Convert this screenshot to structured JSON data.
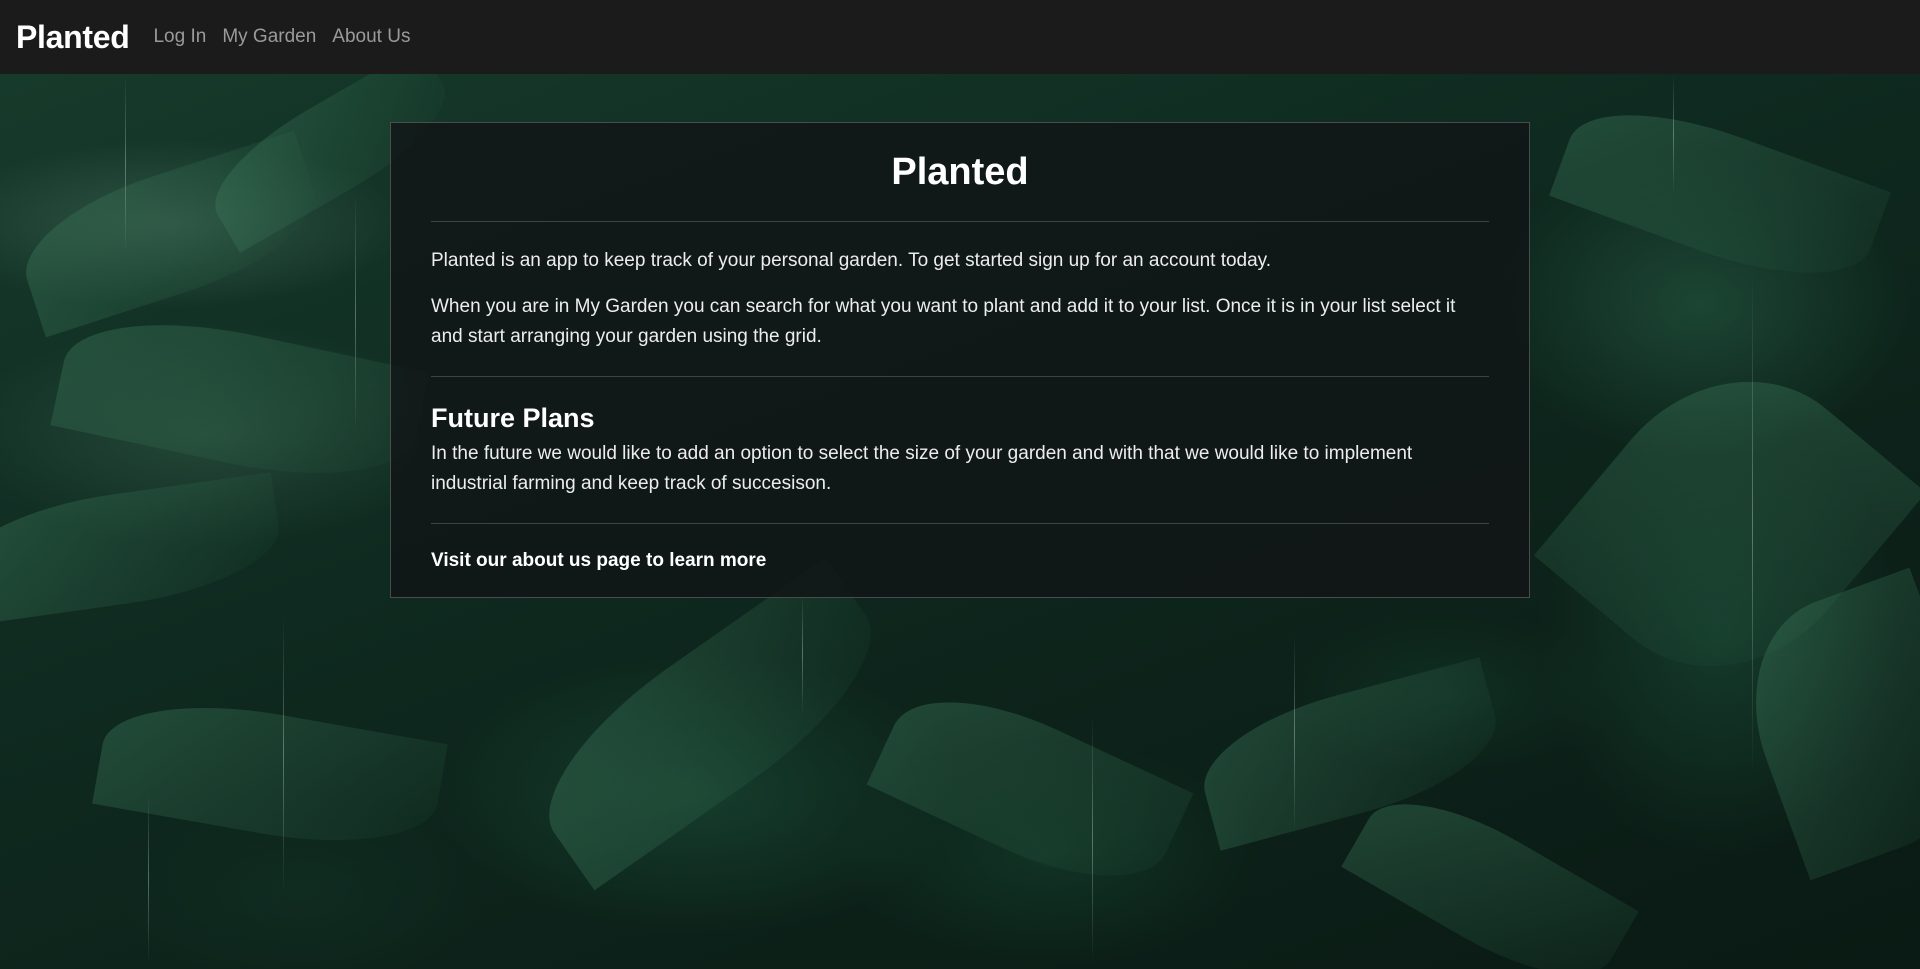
{
  "navbar": {
    "brand": "Planted",
    "links": [
      "Log In",
      "My Garden",
      "About Us"
    ]
  },
  "card": {
    "title": "Planted",
    "intro_paragraphs": [
      "Planted is an app to keep track of your personal garden. To get started sign up for an account today.",
      "When you are in My Garden you can search for what you want to plant and add it to your list. Once it is in your list select it and start arranging your garden using the grid."
    ],
    "future_title": "Future Plans",
    "future_text": "In the future we would like to add an option to select the size of your garden and with that we would like to implement industrial farming and keep track of succesison.",
    "learn_more": "Visit our about us page to learn more"
  },
  "colors": {
    "navbar_bg": "#1b1b1b",
    "nav_link": "#9a9a9a",
    "card_bg": "#111516",
    "text": "#ffffff"
  }
}
